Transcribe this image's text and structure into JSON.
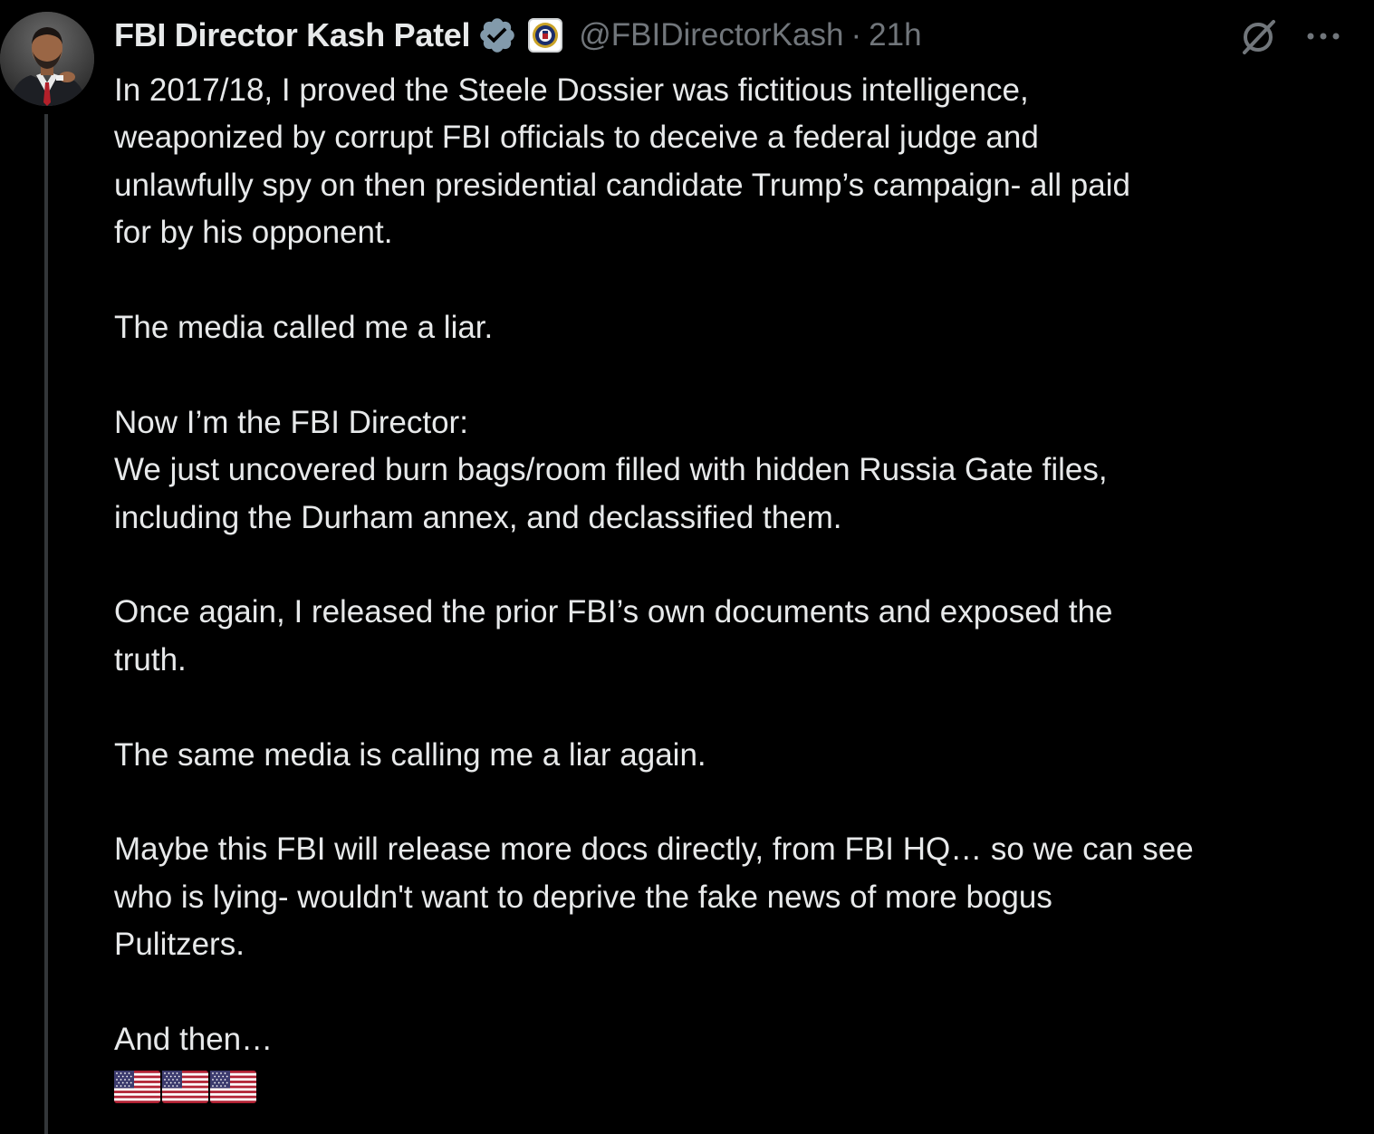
{
  "post": {
    "author": {
      "display_name": "FBI Director Kash Patel",
      "handle": "@FBIDirectorKash",
      "separator": "·",
      "timestamp": "21h",
      "verified": true,
      "affiliate_badge": "fbi-seal-icon"
    },
    "icons": {
      "grok": "grok-icon",
      "more": "more-icon",
      "verified": "verified-badge-icon",
      "flag": "us-flag-icon"
    },
    "paragraphs": [
      "In 2017/18, I proved the Steele Dossier was fictitious intelligence,\nweaponized by corrupt FBI officials to deceive a federal judge and\nunlawfully spy on then presidential candidate Trump’s campaign- all paid\nfor by his opponent.",
      "The media called me a liar.",
      "Now I’m the FBI Director:\nWe just uncovered burn bags/room filled with hidden Russia Gate files,\nincluding the Durham annex, and declassified them.",
      "Once again, I released the prior FBI’s own documents and exposed the\ntruth.",
      "The same media is calling me a liar again.",
      "Maybe this FBI will release more docs directly, from FBI HQ… so we can see\nwho is lying- wouldn't want to deprive the fake news of more bogus\nPulitzers.",
      "And then…"
    ],
    "emoji": [
      "🇺🇸",
      "🇺🇸",
      "🇺🇸"
    ]
  },
  "colors": {
    "background": "#000000",
    "text_primary": "#e7e9ea",
    "text_secondary": "#71767b",
    "verified_badge": "#829aab",
    "thread_line": "#333639"
  }
}
